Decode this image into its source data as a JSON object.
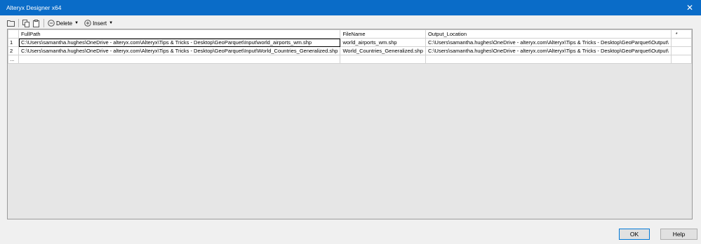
{
  "window": {
    "title": "Alteryx Designer x64",
    "close_glyph": "✕"
  },
  "toolbar": {
    "delete_label": "Delete",
    "insert_label": "Insert",
    "icons": [
      "folder-open-icon",
      "copy-icon",
      "paste-icon",
      "delete-circle-icon",
      "insert-circle-icon"
    ]
  },
  "grid": {
    "columns": [
      "FullPath",
      "FileName",
      "Output_Location",
      "*"
    ],
    "rows": [
      {
        "num": "1",
        "cells": [
          "C:\\Users\\samantha.hughes\\OneDrive - alteryx.com\\Alteryx\\Tips & Tricks - Desktop\\GeoParquet\\Input\\world_airports_wm.shp",
          "world_airports_wm.shp",
          "C:\\Users\\samantha.hughes\\OneDrive - alteryx.com\\Alteryx\\Tips & Tricks - Desktop\\GeoParquet\\Output\\",
          ""
        ]
      },
      {
        "num": "2",
        "cells": [
          "C:\\Users\\samantha.hughes\\OneDrive - alteryx.com\\Alteryx\\Tips & Tricks - Desktop\\GeoParquet\\Input\\World_Countries_Generalized.shp",
          "World_Countries_Generalized.shp",
          "C:\\Users\\samantha.hughes\\OneDrive - alteryx.com\\Alteryx\\Tips & Tricks - Desktop\\GeoParquet\\Output\\",
          ""
        ]
      }
    ],
    "new_row_marker": "..."
  },
  "footer": {
    "ok_label": "OK",
    "help_label": "Help"
  },
  "colors": {
    "titlebar": "#0a6cc8",
    "grid_background": "#e6e6e6"
  }
}
